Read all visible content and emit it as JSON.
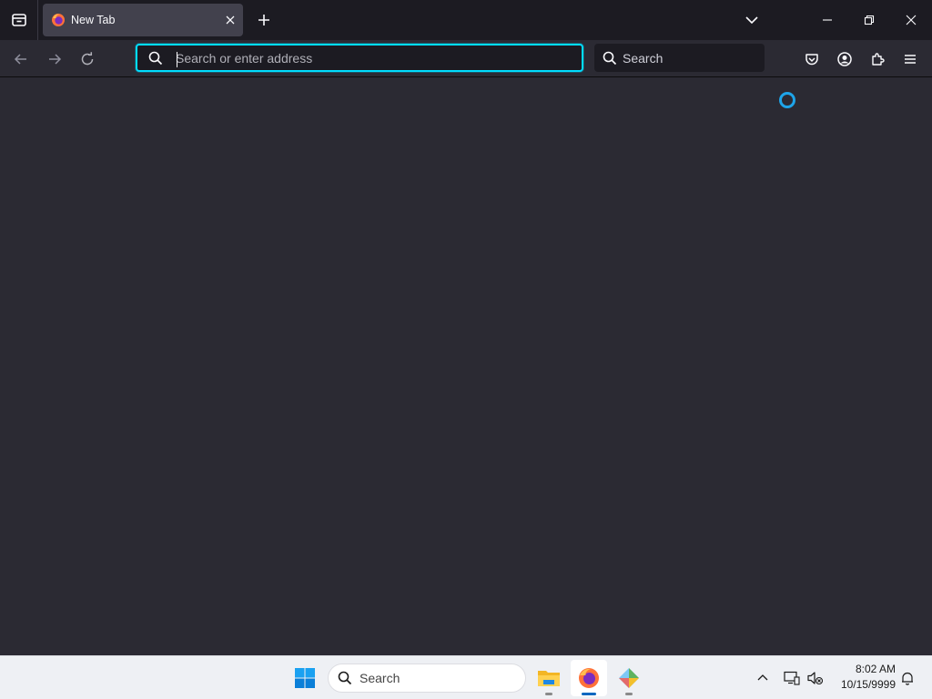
{
  "tabs": [
    {
      "title": "New Tab",
      "close_label": "×"
    }
  ],
  "toolbar": {
    "urlbar_placeholder": "Search or enter address",
    "searchbar_placeholder": "Search"
  },
  "taskbar": {
    "search_label": "Search",
    "apps": [
      "file-explorer",
      "firefox",
      "app-installer"
    ],
    "active_app": "firefox"
  },
  "clock": {
    "time": "8:02 AM",
    "date": "10/15/9999"
  },
  "colors": {
    "accent": "#00ddff",
    "spinner": "#1ea4e9",
    "chrome_dark": "#1c1b22",
    "content_bg": "#2b2a33",
    "tab_active": "#42414d"
  },
  "icons": {
    "tab_list": "firefox-view-icon",
    "new_tab": "plus-icon",
    "all_tabs": "chevron-down-icon",
    "back": "back-arrow-icon",
    "forward": "forward-arrow-icon",
    "reload": "reload-icon",
    "pocket": "pocket-icon",
    "account": "account-icon",
    "extensions": "extensions-icon",
    "menu": "hamburger-menu-icon"
  }
}
